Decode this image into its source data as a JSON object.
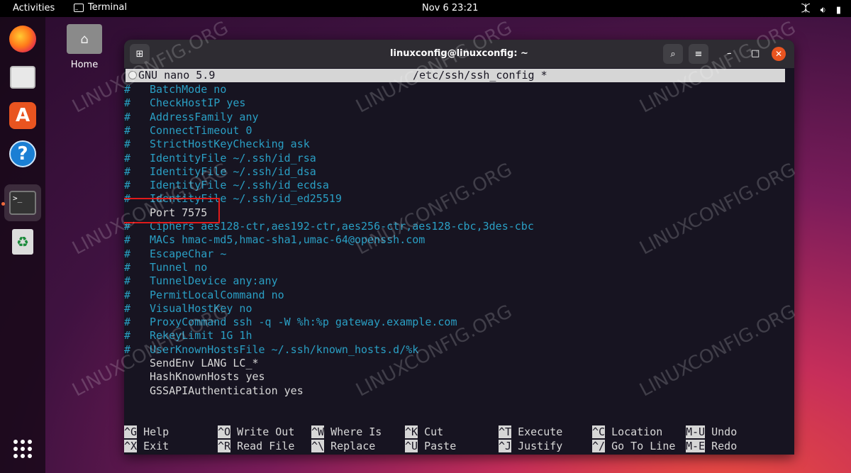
{
  "topbar": {
    "activities": "Activities",
    "app_name": "Terminal",
    "clock": "Nov 6  23:21"
  },
  "desktop": {
    "home_label": "Home"
  },
  "window": {
    "title": "linuxconfig@linuxconfig: ~"
  },
  "nano": {
    "version": "GNU nano 5.9",
    "filename": "/etc/ssh/ssh_config *",
    "lines": [
      {
        "hash": "#",
        "text": "BatchMode no"
      },
      {
        "hash": "#",
        "text": "CheckHostIP yes"
      },
      {
        "hash": "#",
        "text": "AddressFamily any"
      },
      {
        "hash": "#",
        "text": "ConnectTimeout 0"
      },
      {
        "hash": "#",
        "text": "StrictHostKeyChecking ask"
      },
      {
        "hash": "#",
        "text": "IdentityFile ~/.ssh/id_rsa"
      },
      {
        "hash": "#",
        "text": "IdentityFile ~/.ssh/id_dsa"
      },
      {
        "hash": "#",
        "text": "IdentityFile ~/.ssh/id_ecdsa"
      },
      {
        "hash": "#",
        "text": "IdentityFile ~/.ssh/id_ed25519"
      },
      {
        "hash": "",
        "text": "Port 7575"
      },
      {
        "hash": "#",
        "text": "Ciphers aes128-ctr,aes192-ctr,aes256-ctr,aes128-cbc,3des-cbc"
      },
      {
        "hash": "#",
        "text": "MACs hmac-md5,hmac-sha1,umac-64@openssh.com"
      },
      {
        "hash": "#",
        "text": "EscapeChar ~"
      },
      {
        "hash": "#",
        "text": "Tunnel no"
      },
      {
        "hash": "#",
        "text": "TunnelDevice any:any"
      },
      {
        "hash": "#",
        "text": "PermitLocalCommand no"
      },
      {
        "hash": "#",
        "text": "VisualHostKey no"
      },
      {
        "hash": "#",
        "text": "ProxyCommand ssh -q -W %h:%p gateway.example.com"
      },
      {
        "hash": "#",
        "text": "RekeyLimit 1G 1h"
      },
      {
        "hash": "#",
        "text": "UserKnownHostsFile ~/.ssh/known_hosts.d/%k"
      },
      {
        "hash": "",
        "text": "SendEnv LANG LC_*"
      },
      {
        "hash": "",
        "text": "HashKnownHosts yes"
      },
      {
        "hash": "",
        "text": "GSSAPIAuthentication yes"
      }
    ],
    "shortcuts": [
      {
        "key": "^G",
        "label": "Help"
      },
      {
        "key": "^X",
        "label": "Exit"
      },
      {
        "key": "^O",
        "label": "Write Out"
      },
      {
        "key": "^R",
        "label": "Read File"
      },
      {
        "key": "^W",
        "label": "Where Is"
      },
      {
        "key": "^\\",
        "label": "Replace"
      },
      {
        "key": "^K",
        "label": "Cut"
      },
      {
        "key": "^U",
        "label": "Paste"
      },
      {
        "key": "^T",
        "label": "Execute"
      },
      {
        "key": "^J",
        "label": "Justify"
      },
      {
        "key": "^C",
        "label": "Location"
      },
      {
        "key": "^/",
        "label": "Go To Line"
      },
      {
        "key": "M-U",
        "label": "Undo"
      },
      {
        "key": "M-E",
        "label": "Redo"
      }
    ]
  },
  "watermark": "LINUXCONFIG.ORG",
  "colors": {
    "accent": "#e95420",
    "comment": "#2a9fc4",
    "highlight_box": "#e01b1b"
  }
}
